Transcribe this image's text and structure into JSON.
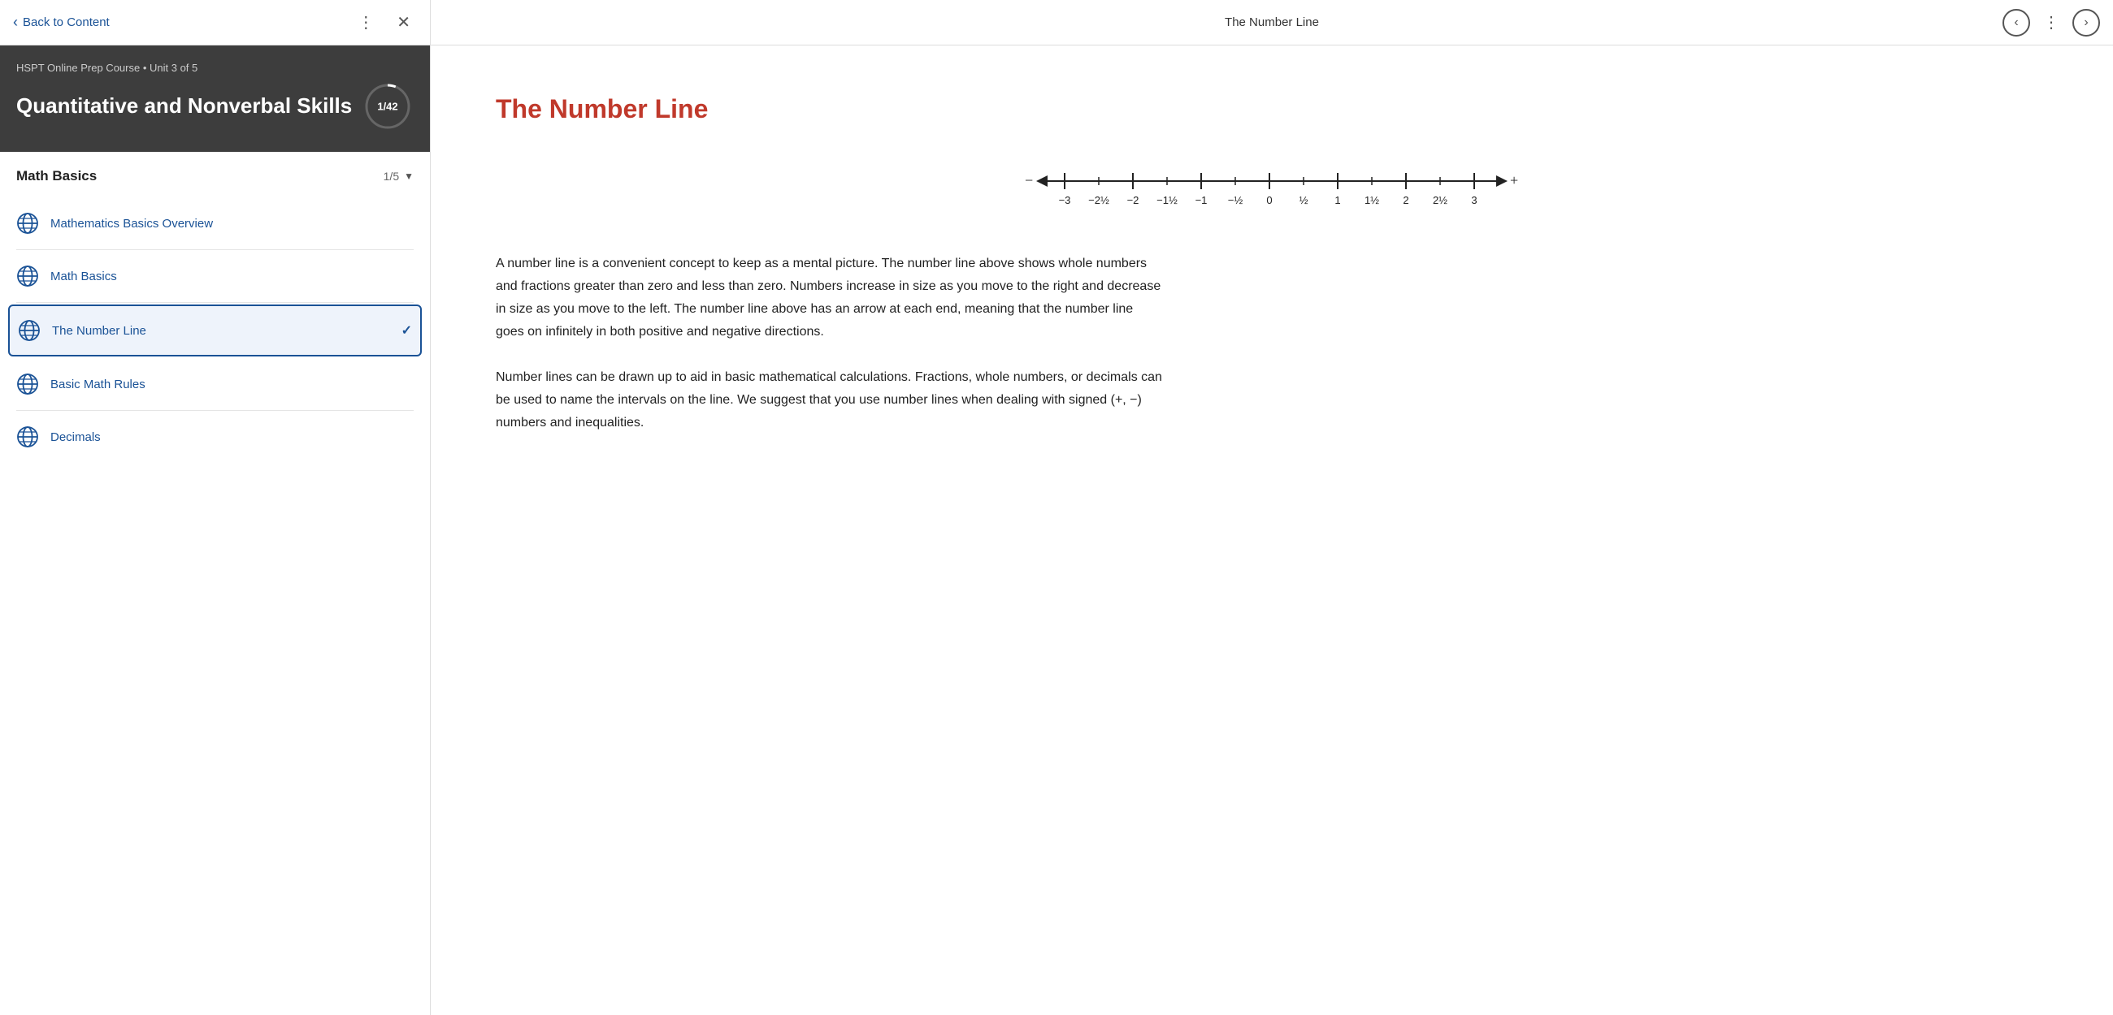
{
  "topNav": {
    "backLabel": "Back to Content",
    "pageTitle": "The Number Line",
    "dotsLabel": "⋮",
    "closeLabel": "✕",
    "prevLabel": "‹",
    "nextLabel": "›"
  },
  "sidebar": {
    "courseMeta": "HSPT Online Prep Course  •  Unit 3 of 5",
    "courseTitle": "Quantitative and Nonverbal Skills",
    "progress": "1/42",
    "sectionTitle": "Math Basics",
    "sectionCount": "1/5",
    "items": [
      {
        "id": "math-basics-overview",
        "label": "Mathematics Basics Overview",
        "active": false,
        "checked": false
      },
      {
        "id": "math-basics",
        "label": "Math Basics",
        "active": false,
        "checked": false
      },
      {
        "id": "number-line",
        "label": "The Number Line",
        "active": true,
        "checked": true
      },
      {
        "id": "basic-math-rules",
        "label": "Basic Math Rules",
        "active": false,
        "checked": false
      },
      {
        "id": "decimals",
        "label": "Decimals",
        "active": false,
        "checked": false
      }
    ]
  },
  "content": {
    "heading": "The Number Line",
    "paragraph1": "A number line is a convenient concept to keep as a mental picture. The number line above shows whole numbers and fractions greater than zero and less than zero. Numbers increase in size as you move to the right and decrease in size as you move to the left. The number line above has an arrow at each end, meaning that the number line goes on infinitely in both positive and negative directions.",
    "paragraph2": "Number lines can be drawn up to aid in basic mathematical calculations. Fractions, whole numbers, or decimals can be used to name the intervals on the line. We suggest that you use number lines when dealing with signed (+, −) numbers and inequalities."
  },
  "numberLine": {
    "labels": [
      "-3",
      "-2½",
      "-2",
      "-1½",
      "-1",
      "-½",
      "0",
      "½",
      "1",
      "1½",
      "2",
      "2½",
      "3"
    ]
  },
  "colors": {
    "accent": "#c0392b",
    "linkBlue": "#1a5296",
    "sidebarBg": "#3d3d3d"
  }
}
